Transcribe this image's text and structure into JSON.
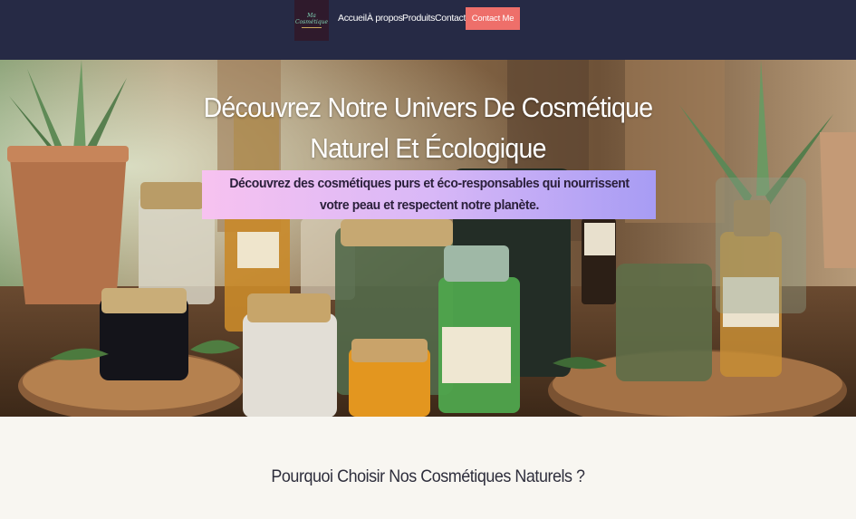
{
  "header": {
    "logo_text": "Ma Cosmétique",
    "nav": [
      {
        "label": "Accueil"
      },
      {
        "label": "À propos"
      },
      {
        "label": "Produits"
      },
      {
        "label": "Contact"
      }
    ],
    "cta_label": "Contact Me"
  },
  "hero": {
    "title": "Découvrez Notre Univers De Cosmétique Naturel Et Écologique",
    "subtitle": "Découvrez des cosmétiques purs et éco-responsables qui nourrissent votre peau et respectent notre planète."
  },
  "section": {
    "title": "Pourquoi Choisir Nos Cosmétiques Naturels ?"
  },
  "colors": {
    "topbar": "#262a45",
    "cta": "#ee6f6a",
    "page_bg": "#f8f6f1"
  }
}
